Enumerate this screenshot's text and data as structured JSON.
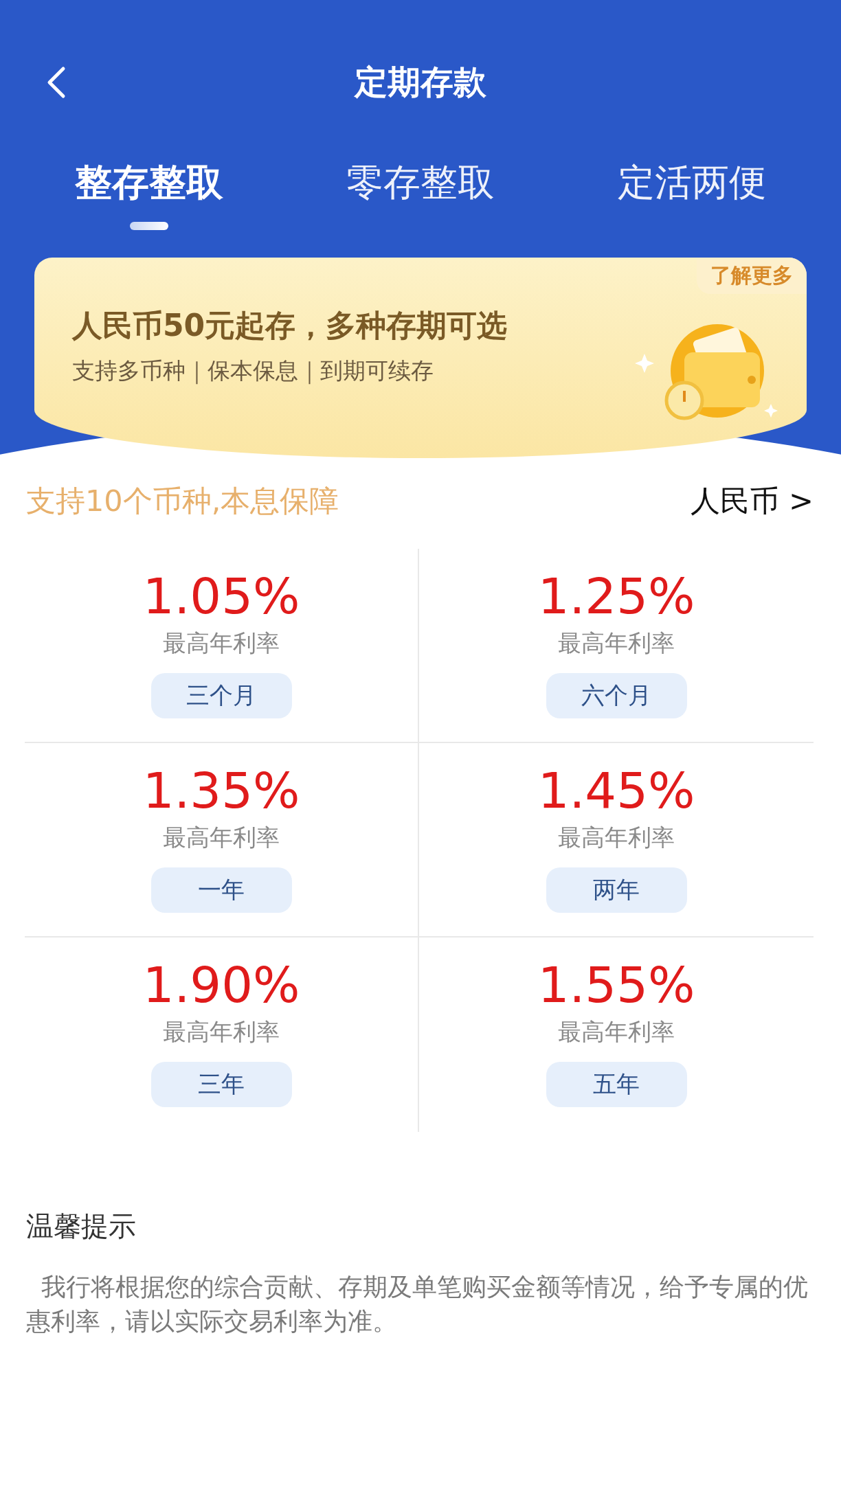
{
  "header": {
    "title": "定期存款"
  },
  "tabs": [
    {
      "label": "整存整取",
      "selected": true
    },
    {
      "label": "零存整取",
      "selected": false
    },
    {
      "label": "定活两便",
      "selected": false
    }
  ],
  "banner": {
    "badge": "了解更多",
    "title": "人民币50元起存，多种存期可选",
    "subtitle": "支持多币种｜保本保息｜到期可续存"
  },
  "currency_bar": {
    "note": "支持10个币种,本息保障",
    "currency": "人民币 >"
  },
  "rates": [
    {
      "rate": "1.05%",
      "label": "最高年利率",
      "term": "三个月"
    },
    {
      "rate": "1.25%",
      "label": "最高年利率",
      "term": "六个月"
    },
    {
      "rate": "1.35%",
      "label": "最高年利率",
      "term": "一年"
    },
    {
      "rate": "1.45%",
      "label": "最高年利率",
      "term": "两年"
    },
    {
      "rate": "1.90%",
      "label": "最高年利率",
      "term": "三年"
    },
    {
      "rate": "1.55%",
      "label": "最高年利率",
      "term": "五年"
    }
  ],
  "tips": {
    "title": "温馨提示",
    "text": "我行将根据您的综合贡献、存期及单笔购买金额等情况，给予专属的优惠利率，请以实际交易利率为准。"
  }
}
